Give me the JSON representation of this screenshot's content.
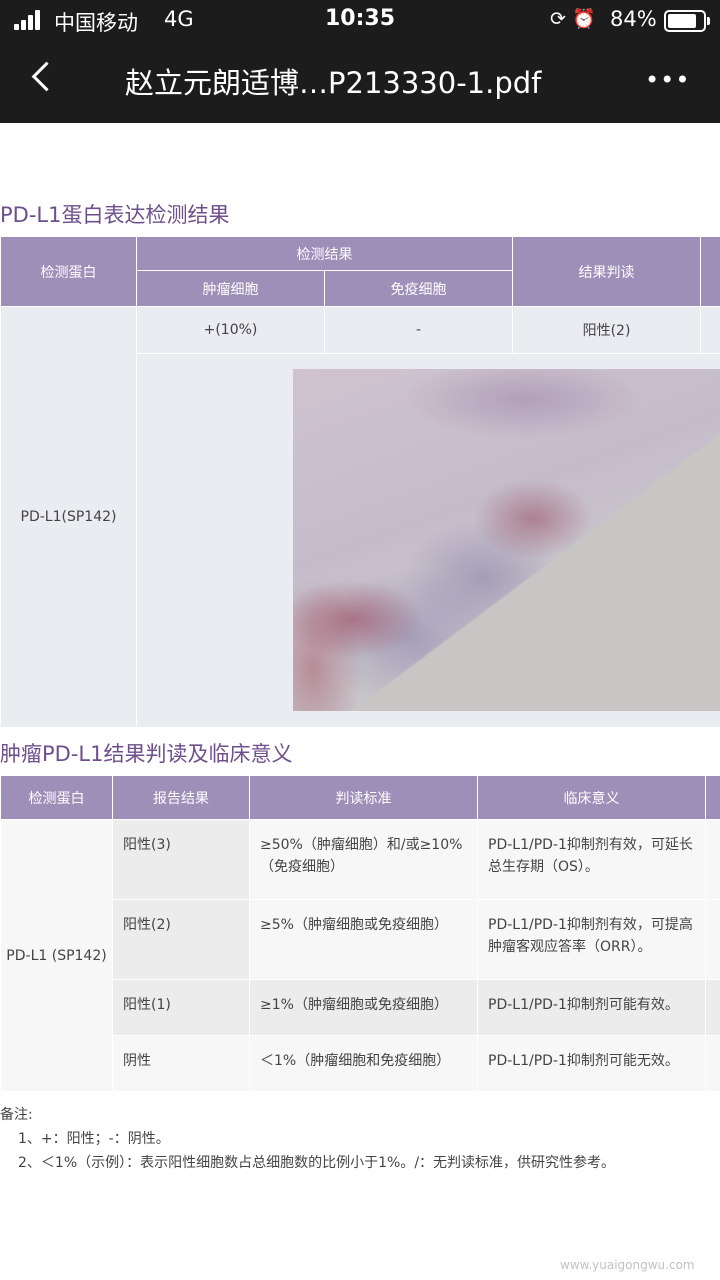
{
  "status_bar": {
    "carrier": "中国移动",
    "network": "4G",
    "time": "10:35",
    "battery": "84%",
    "battery_level": 0.84,
    "icons": [
      "signal-icon",
      "rotation-lock-icon",
      "alarm-icon",
      "battery-icon"
    ]
  },
  "nav": {
    "back_icon": "chevron-left-icon",
    "title": "赵立元朗适博…P213330-1.pdf",
    "more": "•••"
  },
  "section1": {
    "title": "PD-L1蛋白表达检测结果",
    "headers": {
      "protein": "检测蛋白",
      "result": "检测结果",
      "tumor": "肿瘤细胞",
      "immune": "免疫细胞",
      "judgement": "结果判读"
    },
    "row": {
      "protein": "PD-L1(SP142)",
      "tumor": "+(10%)",
      "immune": "-",
      "judgement": "阳性(2)"
    }
  },
  "section2": {
    "title": "肿瘤PD-L1结果判读及临床意义",
    "headers": [
      "检测蛋白",
      "报告结果",
      "判读标准",
      "临床意义"
    ],
    "protein": "PD-L1 (SP142)",
    "rows": [
      {
        "result": "阳性(3)",
        "criteria": "≥50%（肿瘤细胞）和/或≥10%（免疫细胞）",
        "meaning": "PD-L1/PD-1抑制剂有效，可延长总生存期（OS）。"
      },
      {
        "result": "阳性(2)",
        "criteria": "≥5%（肿瘤细胞或免疫细胞）",
        "meaning": "PD-L1/PD-1抑制剂有效，可提高肿瘤客观应答率（ORR）。"
      },
      {
        "result": "阳性(1)",
        "criteria": "≥1%（肿瘤细胞或免疫细胞）",
        "meaning": "PD-L1/PD-1抑制剂可能有效。"
      },
      {
        "result": "阴性",
        "criteria": "＜1%（肿瘤细胞和免疫细胞）",
        "meaning": "PD-L1/PD-1抑制剂可能无效。"
      }
    ]
  },
  "notes": {
    "title": "备注:",
    "items": [
      "1、+：阳性；-：阴性。",
      "2、＜1%（示例）：表示阳性细胞数占总细胞数的比例小于1%。/：无判读标准，供研究性参考。"
    ]
  },
  "watermark": "www.yuaigongwu.com",
  "colors": {
    "header_purple": "#9d8fb8",
    "title_purple": "#6e4f8d",
    "topbar": "#1c1c1c"
  }
}
